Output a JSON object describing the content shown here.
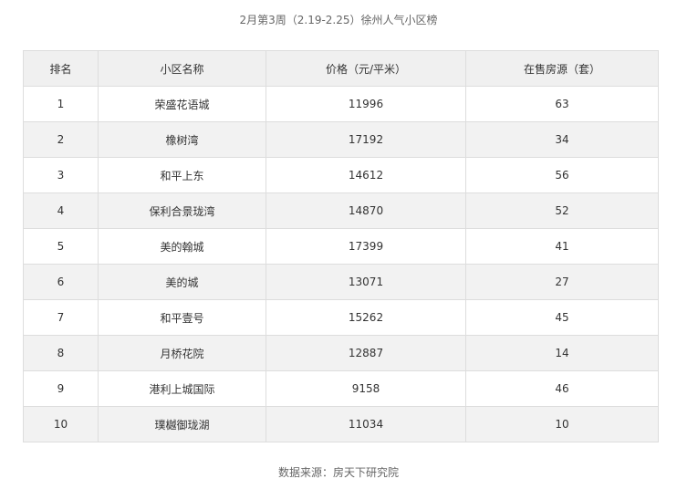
{
  "title": "2月第3周（2.19-2.25）徐州人气小区榜",
  "table": {
    "headers": {
      "rank": "排名",
      "name": "小区名称",
      "price": "价格（元/平米）",
      "stock": "在售房源（套）"
    },
    "rows": [
      {
        "rank": "1",
        "name": "荣盛花语城",
        "price": "11996",
        "stock": "63"
      },
      {
        "rank": "2",
        "name": "橡树湾",
        "price": "17192",
        "stock": "34"
      },
      {
        "rank": "3",
        "name": "和平上东",
        "price": "14612",
        "stock": "56"
      },
      {
        "rank": "4",
        "name": "保利合景珑湾",
        "price": "14870",
        "stock": "52"
      },
      {
        "rank": "5",
        "name": "美的翰城",
        "price": "17399",
        "stock": "41"
      },
      {
        "rank": "6",
        "name": "美的城",
        "price": "13071",
        "stock": "27"
      },
      {
        "rank": "7",
        "name": "和平壹号",
        "price": "15262",
        "stock": "45"
      },
      {
        "rank": "8",
        "name": "月桥花院",
        "price": "12887",
        "stock": "14"
      },
      {
        "rank": "9",
        "name": "港利上城国际",
        "price": "9158",
        "stock": "46"
      },
      {
        "rank": "10",
        "name": "璞樾御珑湖",
        "price": "11034",
        "stock": "10"
      }
    ]
  },
  "source": "数据来源：房天下研究院"
}
